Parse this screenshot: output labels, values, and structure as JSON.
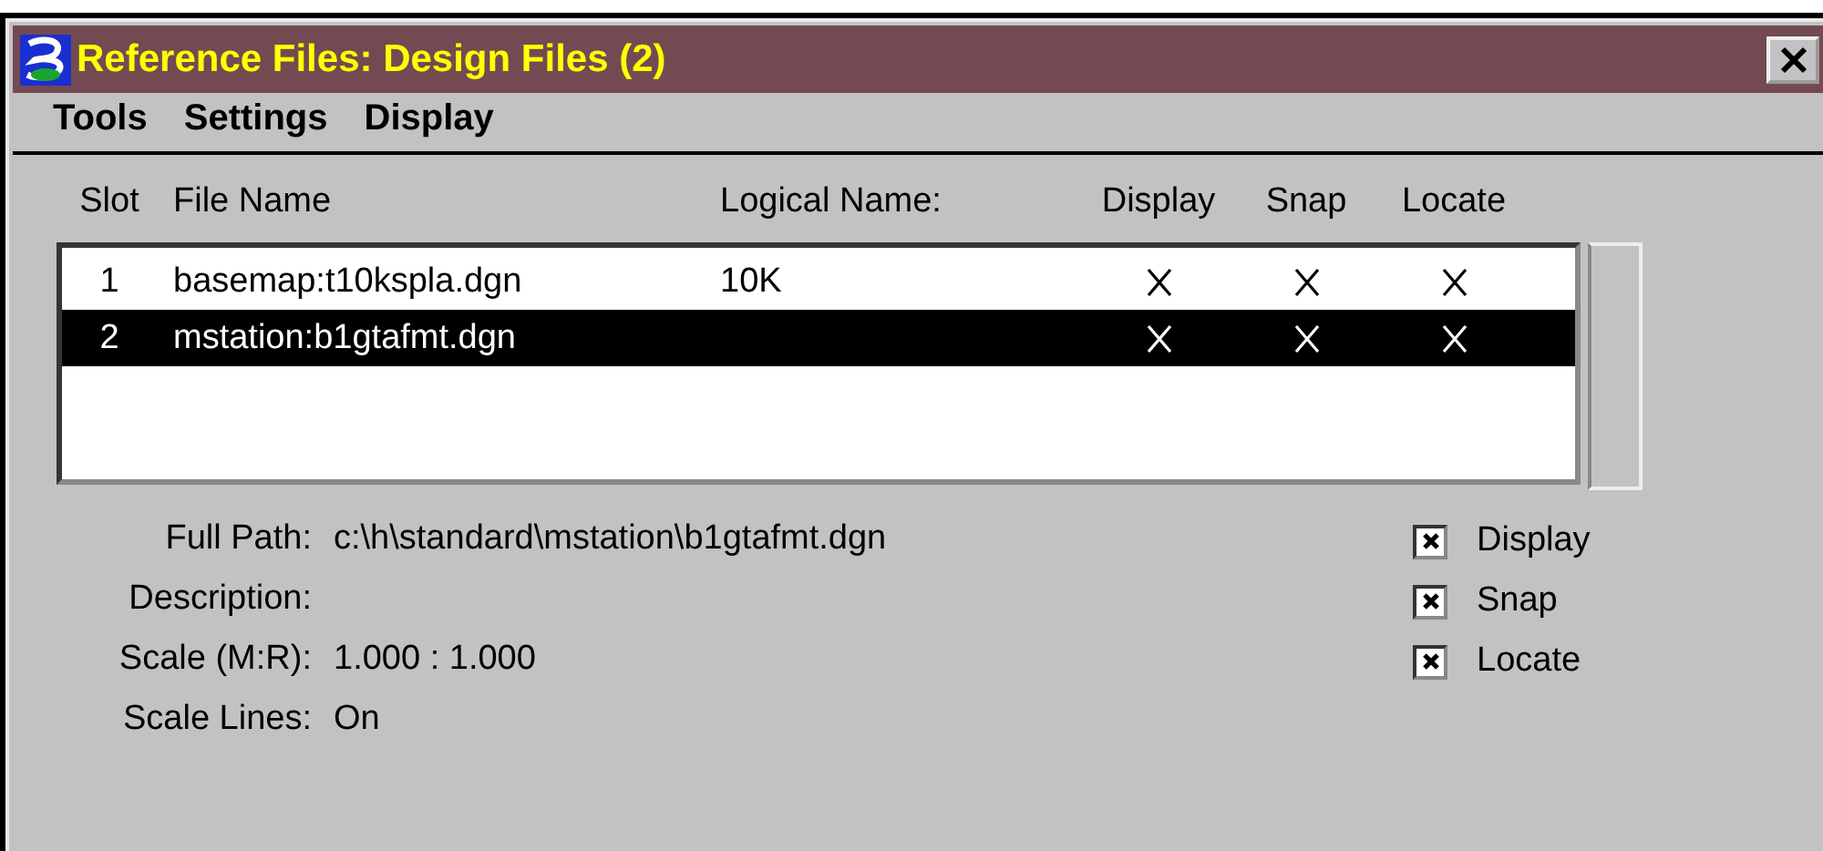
{
  "window": {
    "title": "Reference Files: Design Files (2)"
  },
  "menu": [
    "Tools",
    "Settings",
    "Display"
  ],
  "table": {
    "columns": [
      "Slot",
      "File Name",
      "Logical Name:",
      "Display",
      "Snap",
      "Locate"
    ],
    "rows": [
      {
        "slot": "1",
        "file_name": "basemap:t10kspla.dgn",
        "logical_name": "10K",
        "display": true,
        "snap": true,
        "locate": true,
        "selected": false
      },
      {
        "slot": "2",
        "file_name": "mstation:b1gtafmt.dgn",
        "display": true,
        "snap": true,
        "locate": true,
        "selected": true
      }
    ]
  },
  "details": [
    {
      "label": "Full Path:",
      "value": "c:\\h\\standard\\mstation\\b1gtafmt.dgn"
    },
    {
      "label": "Description:"
    },
    {
      "label": "Scale (M:R):",
      "value": "1.000 : 1.000"
    },
    {
      "label": "Scale Lines:",
      "value": "On"
    }
  ],
  "options": [
    {
      "label": "Display",
      "checked": true
    },
    {
      "label": "Snap",
      "checked": true
    },
    {
      "label": "Locate",
      "checked": true
    }
  ]
}
